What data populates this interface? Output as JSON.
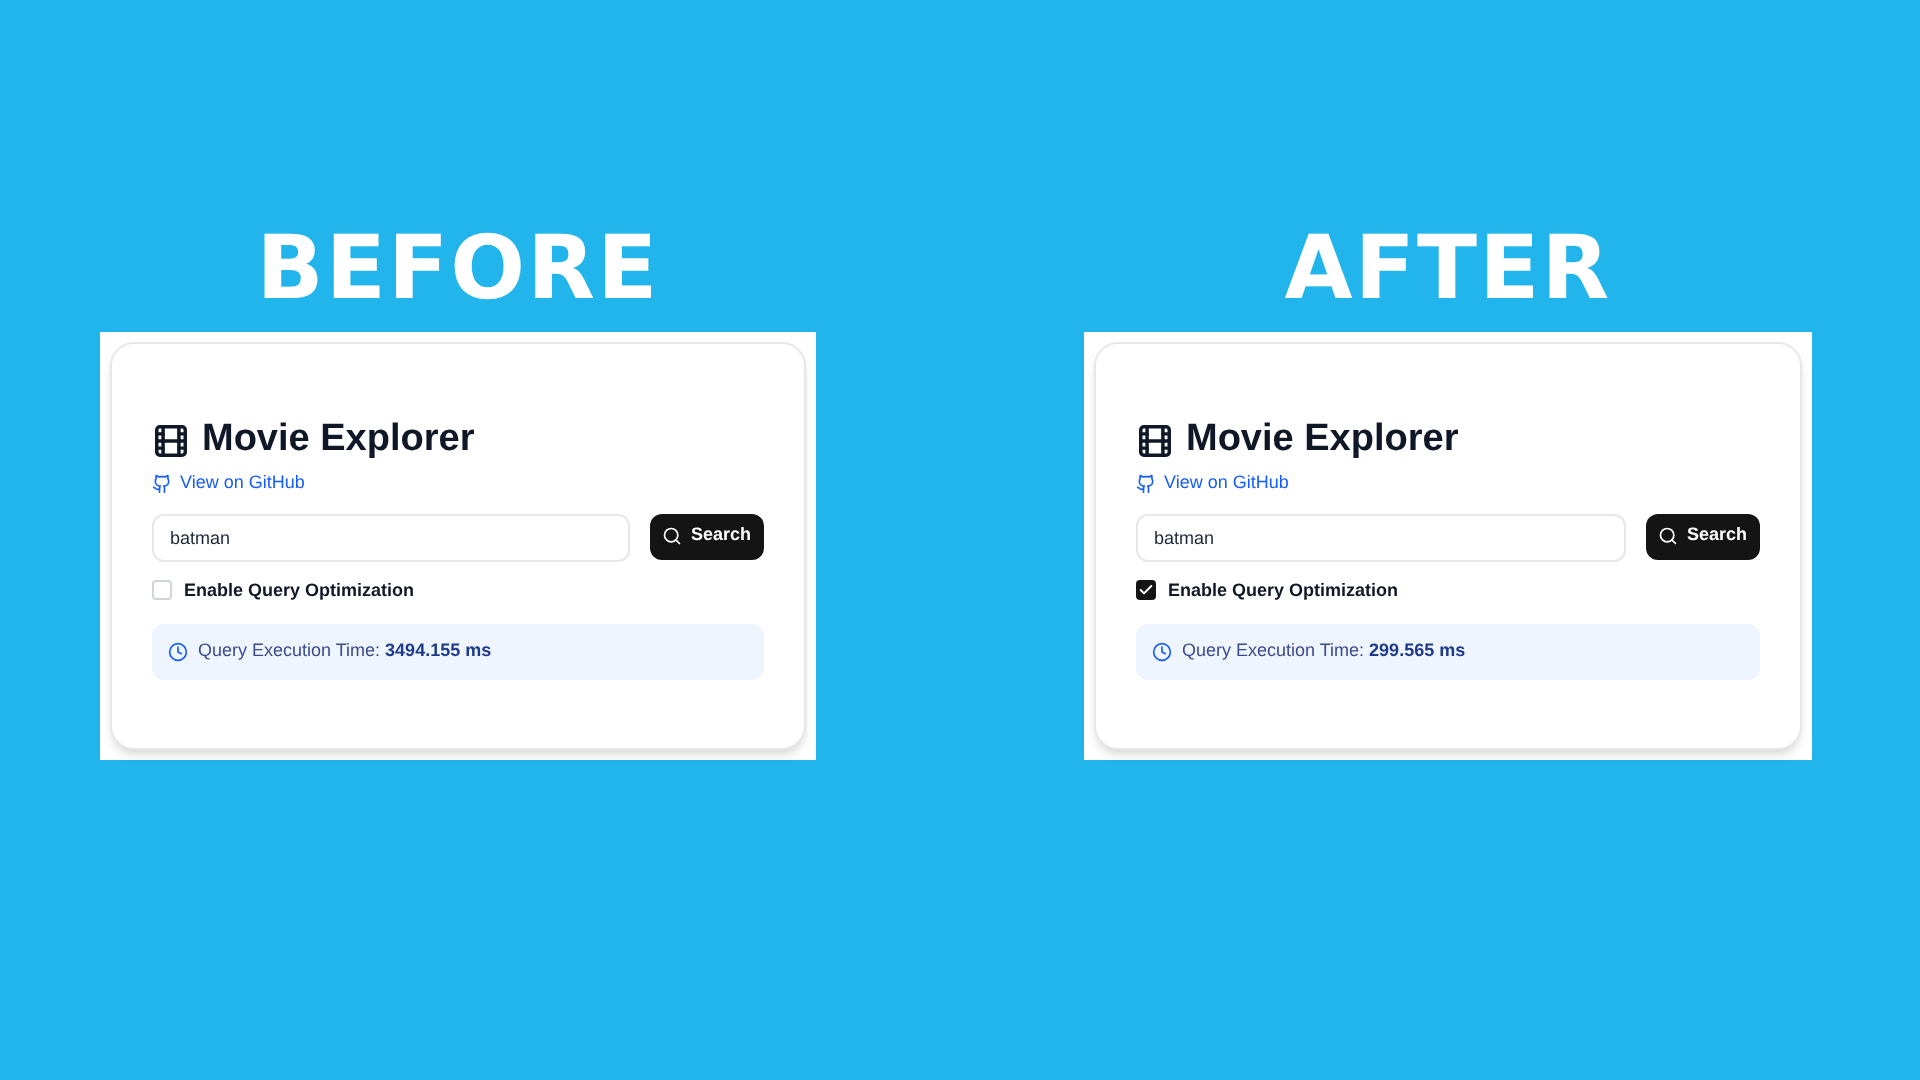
{
  "panels": [
    {
      "heading": "BEFORE",
      "app": {
        "title": "Movie Explorer",
        "github_link": "View on GitHub",
        "search": {
          "value": "batman"
        },
        "search_button": "Search",
        "optimization": {
          "label": "Enable Query Optimization",
          "checked": false
        },
        "timing": "Query Execution Time: **3494.155 ms**"
      }
    },
    {
      "heading": "AFTER",
      "app": {
        "title": "Movie Explorer",
        "github_link": "View on GitHub",
        "search": {
          "value": "batman"
        },
        "search_button": "Search",
        "optimization": {
          "label": "Enable Query Optimization",
          "checked": true
        },
        "timing": "Query Execution Time: **299.565 ms**"
      }
    }
  ]
}
